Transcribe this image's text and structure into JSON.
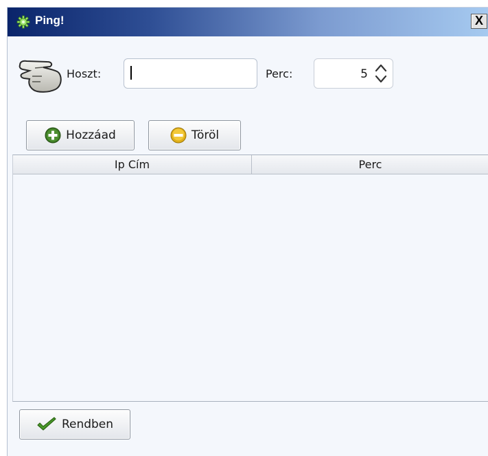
{
  "window": {
    "title": "Ping!",
    "close_label": "X"
  },
  "form": {
    "host_label": "Hoszt:",
    "host_value": "",
    "minutes_label": "Perc:",
    "minutes_value": "5"
  },
  "toolbar": {
    "add_label": "Hozzáad",
    "remove_label": "Töröl"
  },
  "table": {
    "columns": [
      "Ip Cím",
      "Perc"
    ],
    "rows": []
  },
  "footer": {
    "ok_label": "Rendben"
  },
  "colors": {
    "titlebar_start": "#0a246a",
    "titlebar_end": "#a6caf0",
    "add_icon": "#3d7a24",
    "remove_icon": "#e0b01a",
    "check_icon": "#4a9a2a"
  },
  "icons": {
    "title": "gear-icon",
    "hand": "pointing-hand-icon",
    "add": "plus-circle-icon",
    "remove": "minus-circle-icon",
    "ok": "checkmark-icon"
  }
}
